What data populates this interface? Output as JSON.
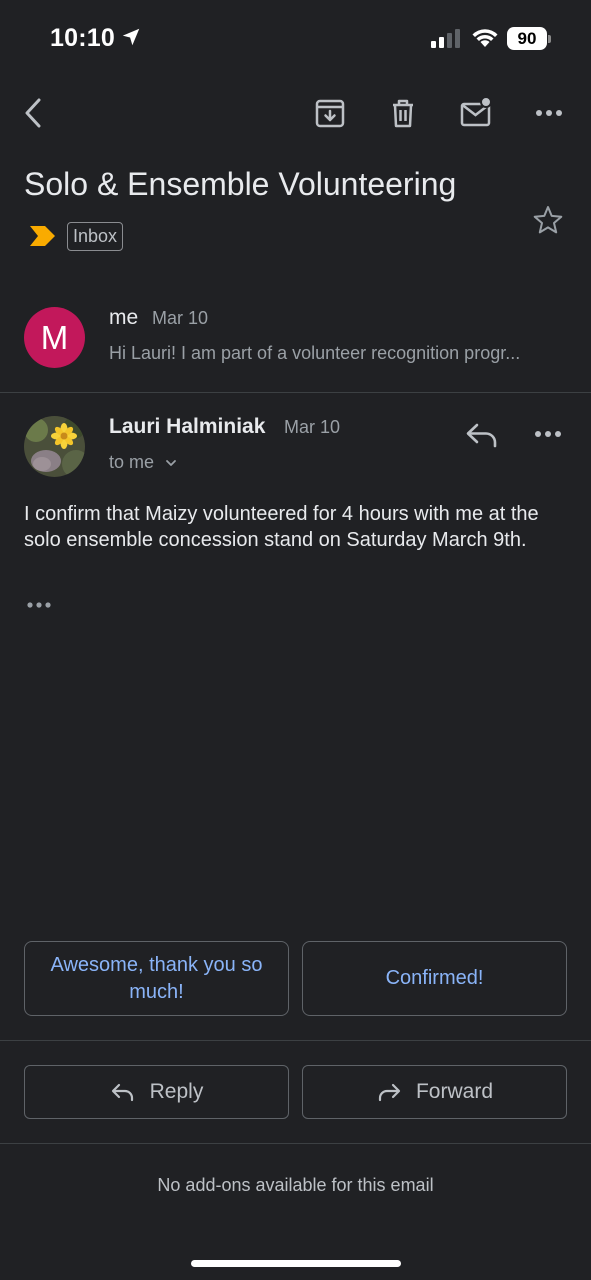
{
  "status_bar": {
    "time": "10:10",
    "battery": "90",
    "icons": [
      "location-arrow-icon",
      "signal-icon",
      "wifi-icon",
      "battery-icon"
    ]
  },
  "toolbar": {
    "icons": [
      "back-icon",
      "archive-icon",
      "trash-icon",
      "mark-unread-icon",
      "more-icon"
    ]
  },
  "thread": {
    "subject": "Solo & Ensemble Volunteering",
    "label": "Inbox",
    "importance_color": "#f9ab00"
  },
  "messages": [
    {
      "avatar_letter": "M",
      "avatar_color": "#c2185b",
      "sender": "me",
      "date": "Mar 10",
      "snippet": "Hi Lauri! I am part of a volunteer recognition progr..."
    },
    {
      "sender": "Lauri Halminiak",
      "date": "Mar 10",
      "recipient": "to me",
      "body": "I confirm that Maizy volunteered for 4 hours with me at the solo ensemble concession stand on Saturday March 9th."
    }
  ],
  "smart_replies": [
    "Awesome, thank you so much!",
    "Confirmed!"
  ],
  "actions": {
    "reply": "Reply",
    "forward": "Forward"
  },
  "footer": {
    "addons": "No add-ons available for this email"
  },
  "colors": {
    "background": "#202124",
    "link_blue": "#8ab4f8"
  }
}
